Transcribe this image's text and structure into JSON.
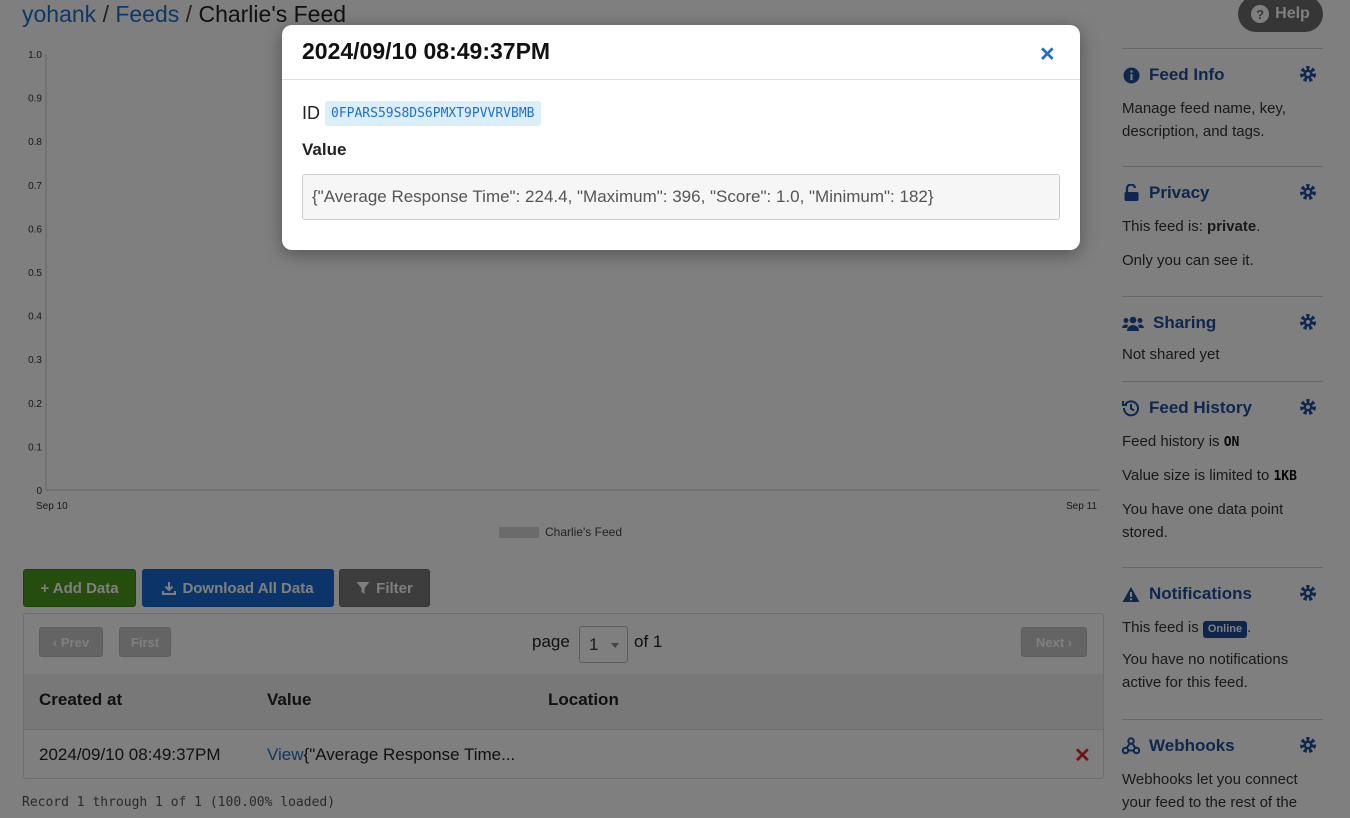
{
  "breadcrumb": {
    "user": "yohank",
    "sep1": "/",
    "feeds": "Feeds",
    "sep2": "/",
    "current": "Charlie's Feed"
  },
  "help": {
    "label": "Help",
    "icon": "question-circle-icon"
  },
  "chart_data": {
    "type": "line",
    "title": "",
    "y_ticks": [
      "1.0",
      "0.9",
      "0.8",
      "0.7",
      "0.6",
      "0.5",
      "0.4",
      "0.3",
      "0.2",
      "0.1",
      "0"
    ],
    "x_ticks": [
      "Sep 10",
      "Sep 11"
    ],
    "ylim": [
      0,
      1.0
    ],
    "series": [
      {
        "name": "Charlie's Feed",
        "values": []
      }
    ],
    "legend_placement": "bottom",
    "grid": false
  },
  "actions": {
    "add": "+ Add Data",
    "download": "Download All Data",
    "filter": "Filter"
  },
  "pager": {
    "prev": "Prev",
    "first": "First",
    "page_label": "page",
    "page_value": "1",
    "of_label": "of 1",
    "next": "Next"
  },
  "table": {
    "headers": [
      "Created at",
      "Value",
      "Location"
    ],
    "rows": [
      {
        "created_at": "2024/09/10 08:49:37PM",
        "view_link": "View",
        "value": "{\"Average Response Time...",
        "location": ""
      }
    ]
  },
  "record_status": "Record 1 through 1 of 1 (100.00% loaded)",
  "sidebar": {
    "feed_info": {
      "title": "Feed Info",
      "text": "Manage feed name, key, description, and tags."
    },
    "privacy": {
      "title": "Privacy",
      "text_prefix": "This feed is: ",
      "status": "private",
      "text_suffix": ".",
      "text2": "Only you can see it."
    },
    "sharing": {
      "title": "Sharing",
      "text": "Not shared yet"
    },
    "history": {
      "title": "Feed History",
      "text_prefix": "Feed history is ",
      "status": "ON",
      "size_prefix": "Value size is limited to ",
      "size": "1KB",
      "text3": "You have one data point stored."
    },
    "notifications": {
      "title": "Notifications",
      "text_prefix": "This feed is ",
      "status": "Online",
      "text_suffix": ".",
      "text2": "You have no notifications active for this feed."
    },
    "webhooks": {
      "title": "Webhooks",
      "text": "Webhooks let you connect your feed to the rest of the"
    }
  },
  "modal": {
    "title": "2024/09/10 08:49:37PM",
    "close": "×",
    "id_label": "ID",
    "id_value": "0FPARS59S8DS6PMXT9PVVRVBMB",
    "value_label": "Value",
    "value": "{\"Average Response Time\": 224.4, \"Maximum\": 396, \"Score\": 1.0, \"Minimum\": 182}"
  },
  "colors": {
    "link": "#1f6fc9",
    "add_button": "#4a9a1c",
    "download_button": "#176bd0",
    "filter_button": "#7a7a7a",
    "sidebar_heading": "#1f4f9a",
    "delete": "#d62b2b"
  }
}
